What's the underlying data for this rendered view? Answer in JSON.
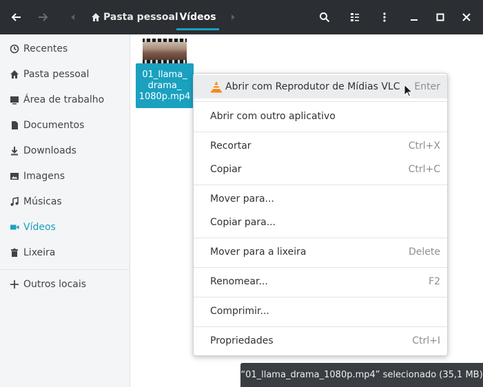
{
  "header": {
    "breadcrumb_home": "Pasta pessoal",
    "breadcrumb_current": "Vídeos"
  },
  "sidebar": {
    "items": [
      {
        "label": "Recentes",
        "icon": "clock-icon"
      },
      {
        "label": "Pasta pessoal",
        "icon": "home-icon"
      },
      {
        "label": "Área de trabalho",
        "icon": "desktop-icon"
      },
      {
        "label": "Documentos",
        "icon": "document-icon"
      },
      {
        "label": "Downloads",
        "icon": "download-icon"
      },
      {
        "label": "Imagens",
        "icon": "image-icon"
      },
      {
        "label": "Músicas",
        "icon": "music-icon"
      },
      {
        "label": "Vídeos",
        "icon": "video-camera-icon",
        "active": true
      },
      {
        "label": "Lixeira",
        "icon": "trash-icon"
      }
    ],
    "other": {
      "label": "Outros locais",
      "icon": "plus-icon"
    }
  },
  "file": {
    "name_line1": "01_llama_",
    "name_line2": "drama_",
    "name_line3": "1080p.mp4"
  },
  "context_menu": {
    "items": [
      {
        "label": "Abrir com Reprodutor de Mídias VLC",
        "accel": "Enter"
      },
      {
        "label": "Abrir com outro aplicativo",
        "accel": ""
      },
      {
        "label": "Recortar",
        "accel": "Ctrl+X"
      },
      {
        "label": "Copiar",
        "accel": "Ctrl+C"
      },
      {
        "label": "Mover para...",
        "accel": ""
      },
      {
        "label": "Copiar para...",
        "accel": ""
      },
      {
        "label": "Mover para a lixeira",
        "accel": "Delete"
      },
      {
        "label": "Renomear...",
        "accel": "F2"
      },
      {
        "label": "Comprimir...",
        "accel": ""
      },
      {
        "label": "Propriedades",
        "accel": "Ctrl+I"
      }
    ]
  },
  "status": {
    "text": "“01_llama_drama_1080p.mp4” selecionado  (35,1 MB)"
  },
  "colors": {
    "accent": "#1aa1c0",
    "headerbar": "#2b2e32",
    "sidebar": "#f4f5f6"
  }
}
